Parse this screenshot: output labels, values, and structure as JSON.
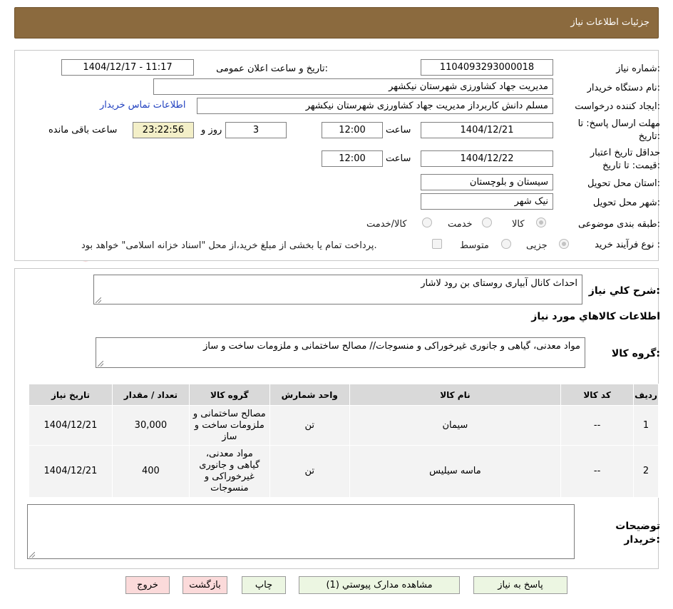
{
  "header": {
    "title": "جزئیات اطلاعات نیاز"
  },
  "watermark": {
    "text": "AriaTender.neT"
  },
  "form": {
    "need_number_label": "شماره نیاز:",
    "need_number": "1104093293000018",
    "announce_label": "تاریخ و ساعت اعلان عمومی:",
    "announce_value": "1404/12/17 - 11:17",
    "buyer_org_label": "نام دستگاه خریدار:",
    "buyer_org": "مدیریت جهاد کشاورزی شهرستان نیکشهر",
    "requester_label": "ایجاد کننده درخواست:",
    "requester": "مسلم دانش کاربرداز مدیریت جهاد کشاورزی شهرستان نیکشهر",
    "contact_link": "اطلاعات تماس خریدار",
    "deadline_label_1": "مهلت ارسال پاسخ: تا",
    "deadline_label_2": "تاریخ:",
    "deadline_date": "1404/12/21",
    "time_label": "ساعت",
    "deadline_time": "12:00",
    "days_value": "3",
    "days_label": "روز و",
    "remaining_time": "23:22:56",
    "remaining_label": "ساعت باقی مانده",
    "validity_label_1": "حداقل تاریخ اعتبار",
    "validity_label_2": "قیمت: تا تاریخ:",
    "validity_date": "1404/12/22",
    "validity_time": "12:00",
    "province_label": "استان محل تحویل:",
    "province": "سیستان و بلوچستان",
    "city_label": "شهر محل تحویل:",
    "city": "نیک شهر",
    "category_label": "طبقه بندی موضوعی:",
    "category_options": [
      "کالا",
      "خدمت",
      "کالا/خدمت"
    ],
    "process_label": "نوع فرآیند خرید :",
    "process_options": [
      "جزیی",
      "متوسط"
    ],
    "payment_note": "پرداخت تمام یا بخشی از مبلغ خرید،از محل \"اسناد خزانه اسلامی\" خواهد بود."
  },
  "summary": {
    "label": "شرح کلي نياز:",
    "value": "احداث کانال آبیاری روستای بن رود لاشار",
    "goods_info_title": "اطلاعات کالاهاي مورد نياز",
    "goods_group_label": "گروه کالا:",
    "goods_group_value": "مواد معدنی، گیاهی و جانوری غیرخوراکی و منسوجات// مصالح ساختمانی و ملزومات ساخت و ساز"
  },
  "table": {
    "headers": [
      "رديف",
      "کد کالا",
      "نام کالا",
      "واحد شمارش",
      "گروه کالا",
      "تعداد / مقدار",
      "تاریخ نیاز"
    ],
    "rows": [
      {
        "row": "1",
        "code": "--",
        "name": "سیمان",
        "unit": "تن",
        "group": "مصالح ساختمانی و ملزومات ساخت و ساز",
        "qty": "30,000",
        "date": "1404/12/21"
      },
      {
        "row": "2",
        "code": "--",
        "name": "ماسه سیلیس",
        "unit": "تن",
        "group": "مواد معدنی، گیاهی و جانوری غیرخوراکی و منسوجات",
        "qty": "400",
        "date": "1404/12/21"
      }
    ]
  },
  "notes": {
    "label_1": "توضیحات",
    "label_2": "خریدار:",
    "value": ""
  },
  "buttons": {
    "reply": "پاسخ به نياز",
    "attachments": "مشاهده مدارک پيوستي (1)",
    "print": "چاپ",
    "back": "بازگشت",
    "exit": "خروج"
  }
}
